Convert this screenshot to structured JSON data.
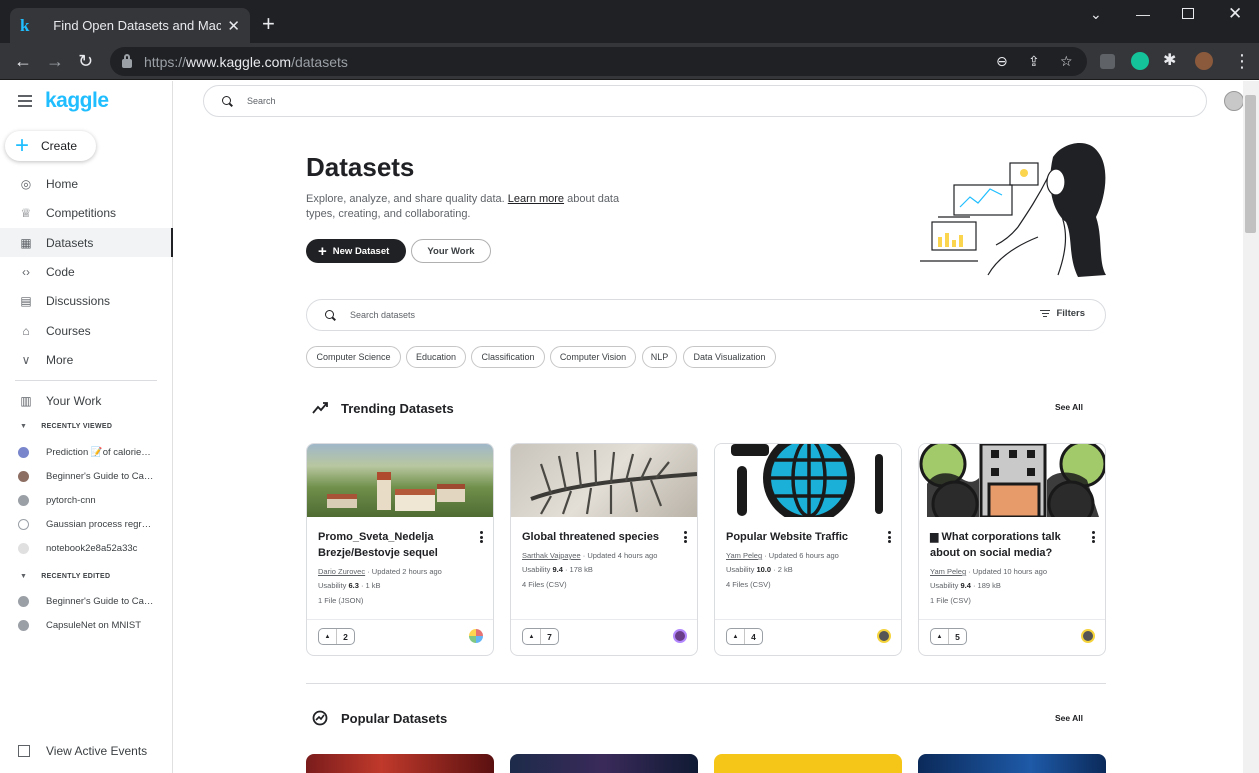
{
  "browser": {
    "tab_title": "Find Open Datasets and Machine Learning Projects | Kaggle",
    "tab_favicon": "k",
    "url_prefix": "https://",
    "url_host": "www.kaggle.com",
    "url_path": "/datasets"
  },
  "sidebar": {
    "logo": "kaggle",
    "create_label": "Create",
    "nav": [
      {
        "label": "Home",
        "icon": "compass-icon"
      },
      {
        "label": "Competitions",
        "icon": "trophy-icon"
      },
      {
        "label": "Datasets",
        "icon": "table-icon",
        "active": true
      },
      {
        "label": "Code",
        "icon": "code-icon"
      },
      {
        "label": "Discussions",
        "icon": "comment-icon"
      },
      {
        "label": "Courses",
        "icon": "graduation-cap-icon"
      },
      {
        "label": "More",
        "icon": "chevron-down-icon"
      }
    ],
    "your_work": "Your Work",
    "recently_viewed_label": "RECENTLY VIEWED",
    "recently_viewed": [
      "Prediction 📝of calorie…",
      "Beginner's Guide to Ca…",
      "pytorch-cnn",
      "Gaussian process regr…",
      "notebook2e8a52a33c"
    ],
    "recently_edited_label": "RECENTLY EDITED",
    "recently_edited": [
      "Beginner's Guide to Ca…",
      "CapsuleNet on MNIST"
    ],
    "view_events": "View Active Events"
  },
  "search": {
    "placeholder": "Search"
  },
  "hero": {
    "title": "Datasets",
    "subtitle_pre": "Explore, analyze, and share quality data. ",
    "subtitle_link": "Learn more",
    "subtitle_post": " about data types, creating, and collaborating.",
    "new_dataset": "New Dataset",
    "your_work": "Your Work"
  },
  "dataset_search": {
    "placeholder": "Search datasets",
    "filters": "Filters"
  },
  "chips": [
    "Computer Science",
    "Education",
    "Classification",
    "Computer Vision",
    "NLP",
    "Data Visualization"
  ],
  "trending": {
    "title": "Trending Datasets",
    "see_all": "See All",
    "cards": [
      {
        "title": "Promo_Sveta_Nedelja Brezje/Bestovje sequel",
        "author": "Dario Zurovec",
        "updated": " · Updated 2 hours ago",
        "usability_label": "Usability ",
        "usability": "6.3",
        "size": " · 1 kB",
        "files": "1 File (JSON)",
        "votes": "2"
      },
      {
        "title": "Global threatened species",
        "author": "Sarthak Vajpayee",
        "updated": " · Updated 4 hours ago",
        "usability_label": "Usability ",
        "usability": "9.4",
        "size": " · 178 kB",
        "files": "4 Files (CSV)",
        "votes": "7"
      },
      {
        "title": "Popular Website Traffic",
        "author": "Yam Peleg",
        "updated": " · Updated 6 hours ago",
        "usability_label": "Usability ",
        "usability": "10.0",
        "size": " · 2 kB",
        "files": "4 Files (CSV)",
        "votes": "4"
      },
      {
        "title": "▆ What corporations talk about on social media?",
        "author": "Yam Peleg",
        "updated": " · Updated 10 hours ago",
        "usability_label": "Usability ",
        "usability": "9.4",
        "size": " · 189 kB",
        "files": "1 File (CSV)",
        "votes": "5"
      }
    ]
  },
  "popular": {
    "title": "Popular Datasets",
    "see_all": "See All"
  }
}
